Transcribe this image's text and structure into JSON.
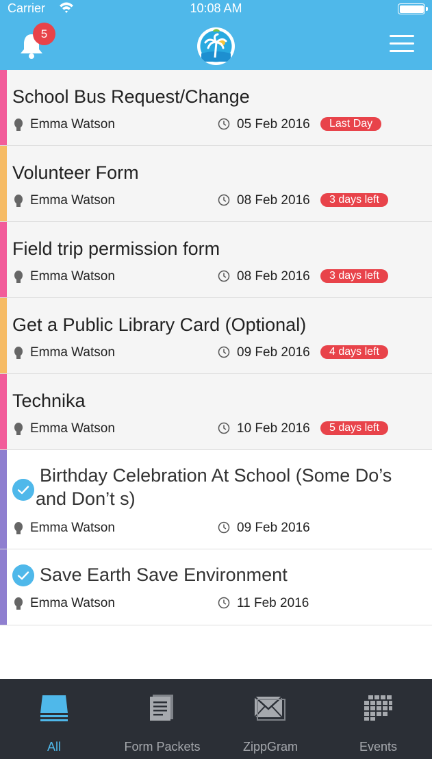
{
  "status_bar": {
    "carrier": "Carrier",
    "time": "10:08 AM"
  },
  "header": {
    "notification_count": "5",
    "bell_icon": "bell-icon",
    "logo_icon": "palm-tree-logo",
    "menu_icon": "hamburger-menu-icon"
  },
  "colors": {
    "primary": "#4fb8ea",
    "badge_red": "#e8434a",
    "accent_pink": "#f25c9a",
    "accent_orange": "#f6bb65",
    "accent_purple": "#8f7fd0",
    "tabbar": "#2b2f36"
  },
  "forms": [
    {
      "title": "School Bus Request/Change",
      "person": "Emma Watson",
      "date": "05 Feb 2016",
      "due": "Last Day",
      "accent": "#f25c9a",
      "completed": false
    },
    {
      "title": "Volunteer Form",
      "person": "Emma Watson",
      "date": "08 Feb 2016",
      "due": "3 days left",
      "accent": "#f6bb65",
      "completed": false
    },
    {
      "title": "Field trip permission form",
      "person": "Emma Watson",
      "date": "08 Feb 2016",
      "due": "3 days left",
      "accent": "#f25c9a",
      "completed": false
    },
    {
      "title": "Get a Public Library Card (Optional)",
      "person": "Emma Watson",
      "date": "09 Feb 2016",
      "due": "4 days left",
      "accent": "#f6bb65",
      "completed": false
    },
    {
      "title": "Technika",
      "person": "Emma Watson",
      "date": "10 Feb 2016",
      "due": "5 days left",
      "accent": "#f25c9a",
      "completed": false
    },
    {
      "title_line1": "Birthday Celebration At School (Some Do’s",
      "title_line2": "and Don’t s)",
      "person": "Emma Watson",
      "date": "09 Feb 2016",
      "accent": "#8f7fd0",
      "completed": true
    },
    {
      "title": "Save Earth Save Environment",
      "person": "Emma Watson",
      "date": "11 Feb 2016",
      "accent": "#8f7fd0",
      "completed": true
    }
  ],
  "tabs": [
    {
      "label": "All",
      "icon": "stack-icon",
      "active": true
    },
    {
      "label": "Form Packets",
      "icon": "document-icon",
      "active": false
    },
    {
      "label": "ZippGram",
      "icon": "envelope-icon",
      "active": false
    },
    {
      "label": "Events",
      "icon": "calendar-grid-icon",
      "active": false
    }
  ]
}
